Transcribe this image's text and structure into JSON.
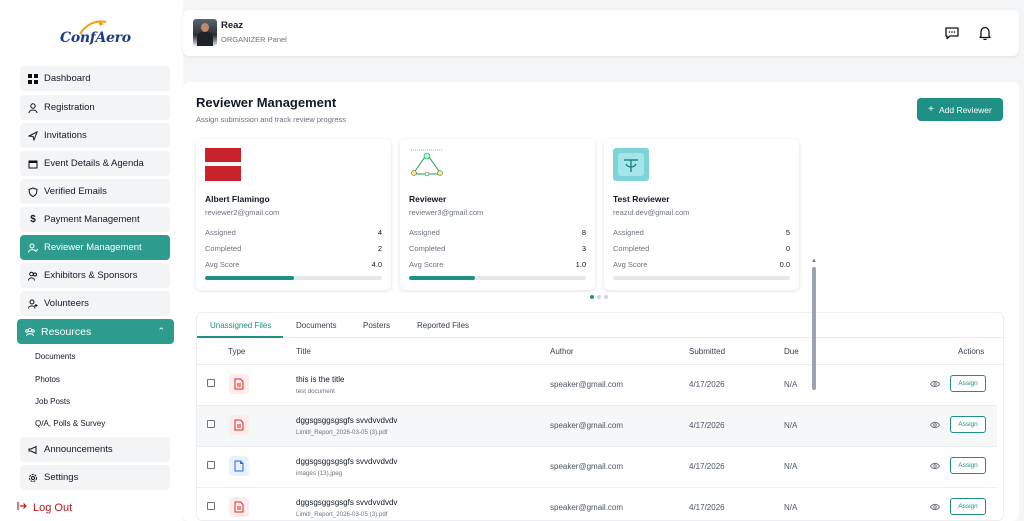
{
  "brand": {
    "logo_text": "ConfAero"
  },
  "sidebar": {
    "items": [
      {
        "label": "Dashboard",
        "icon": "grid-icon"
      },
      {
        "label": "Registration",
        "icon": "user-icon"
      },
      {
        "label": "Invitations",
        "icon": "send-icon"
      },
      {
        "label": "Event Details & Agenda",
        "icon": "calendar-icon"
      },
      {
        "label": "Verified Emails",
        "icon": "shield-icon"
      },
      {
        "label": "Payment Management",
        "icon": "dollar-icon"
      },
      {
        "label": "Reviewer Management",
        "icon": "user-check-icon",
        "active": true
      },
      {
        "label": "Exhibitors & Sponsors",
        "icon": "users-icon"
      },
      {
        "label": "Volunteers",
        "icon": "user-plus-icon"
      }
    ],
    "resources": {
      "label": "Resources",
      "children": [
        "Documents",
        "Photos",
        "Job Posts",
        "Q/A, Polls & Survey"
      ]
    },
    "announcements": "Announcements",
    "settings": "Settings",
    "logout": "Log Out"
  },
  "header": {
    "user_name": "Reaz",
    "user_role": "ORGANIZER Panel"
  },
  "page": {
    "title": "Reviewer Management",
    "subtitle": "Assign submission and track review progress",
    "add_button": "Add Reviewer"
  },
  "reviewers": [
    {
      "name": "Albert Flamingo",
      "email": "reviewer2@gmail.com",
      "assigned_label": "Assigned",
      "assigned": "4",
      "completed_label": "Completed",
      "completed": "2",
      "avg_label": "Avg Score",
      "avg": "4.0",
      "progress": 0.5
    },
    {
      "name": "Reviewer",
      "email": "reviewer3@gmail.com",
      "assigned_label": "Assigned",
      "assigned": "8",
      "completed_label": "Completed",
      "completed": "3",
      "avg_label": "Avg Score",
      "avg": "1.0",
      "progress": 0.375
    },
    {
      "name": "Test Reviewer",
      "email": "reazul.dev@gmail.com",
      "assigned_label": "Assigned",
      "assigned": "5",
      "completed_label": "Completed",
      "completed": "0",
      "avg_label": "Avg Score",
      "avg": "0.0",
      "progress": 0
    }
  ],
  "tabs": [
    "Unassigned Files",
    "Documents",
    "Posters",
    "Reported Files"
  ],
  "table": {
    "headers": {
      "type": "Type",
      "title": "Title",
      "author": "Author",
      "submitted": "Submitted",
      "due": "Due",
      "actions": "Actions"
    },
    "rows": [
      {
        "type": "pdf",
        "title": "this is the title",
        "file": "test document",
        "author": "speaker@gmail.com",
        "submitted": "4/17/2026",
        "due": "N/A",
        "action": "Assign"
      },
      {
        "type": "pdf",
        "title": "dggsgsggsgsgfs svvdvvdvdv",
        "file": "LimitI_Report_2026-03-05 (3).pdf",
        "author": "speaker@gmail.com",
        "submitted": "4/17/2026",
        "due": "N/A",
        "action": "Assign"
      },
      {
        "type": "image",
        "title": "dggsgsggsgsgfs svvdvvdvdv",
        "file": "images (13).jpeg",
        "author": "speaker@gmail.com",
        "submitted": "4/17/2026",
        "due": "N/A",
        "action": "Assign"
      },
      {
        "type": "pdf",
        "title": "dggsgsggsgsgfs svvdvvdvdv",
        "file": "LimitI_Report_2026-03-05 (3).pdf",
        "author": "speaker@gmail.com",
        "submitted": "4/17/2026",
        "due": "N/A",
        "action": "Assign"
      }
    ]
  },
  "colors": {
    "accent": "#1e9085",
    "active_nav": "#2d9c8e",
    "logout": "#b91c1c"
  }
}
